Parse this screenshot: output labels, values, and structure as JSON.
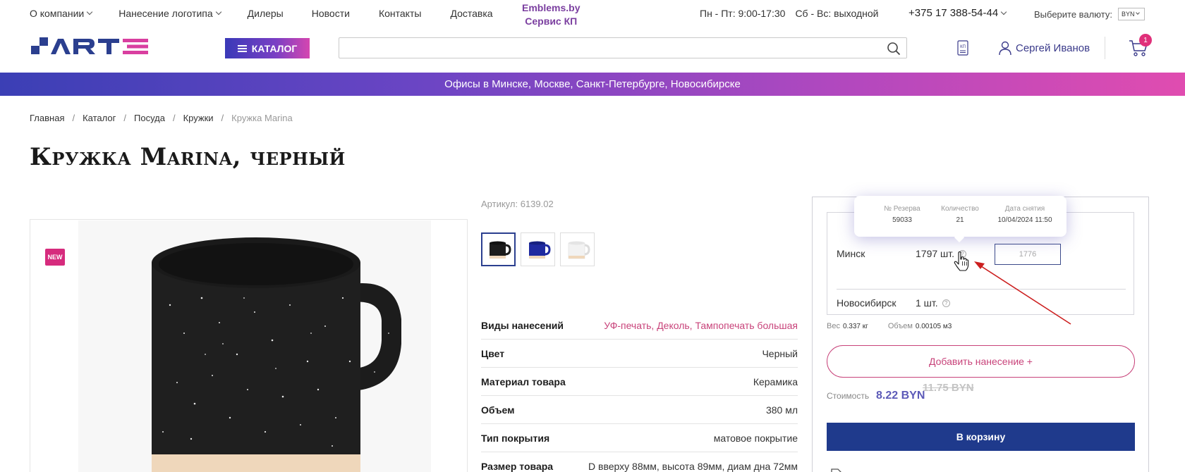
{
  "topbar": {
    "nav": [
      {
        "label": "О компании",
        "dropdown": true
      },
      {
        "label": "Нанесение логотипа",
        "dropdown": true
      },
      {
        "label": "Дилеры",
        "dropdown": false
      },
      {
        "label": "Новости",
        "dropdown": false
      },
      {
        "label": "Контакты",
        "dropdown": false
      },
      {
        "label": "Доставка",
        "dropdown": false
      }
    ],
    "emblems_line1": "Emblems.by",
    "emblems_line2": "Сервис КП",
    "hours_weekdays": "Пн - Пт: 9:00-17:30",
    "hours_weekend": "Сб - Вс: выходной",
    "phone": "+375 17 388-54-44",
    "currency_label": "Выберите валюту:",
    "currency_value": "BYN"
  },
  "header": {
    "logo_text": "ARTE",
    "catalog_label": "КАТАЛОГ",
    "search_placeholder": "",
    "kp_label": "КП",
    "user_name": "Сергей Иванов",
    "cart_count": "1"
  },
  "banner": "Офисы в Минске, Москве, Санкт-Петербурге, Новосибирске",
  "breadcrumbs": [
    "Главная",
    "Каталог",
    "Посуда",
    "Кружки",
    "Кружка Marina"
  ],
  "product": {
    "title": "Кружка Marina, черный",
    "badge": "NEW",
    "sku": "Артикул: 6139.02",
    "thumb_colors": [
      "#1c1c1c",
      "#1f2aa0",
      "#f2f2f2"
    ],
    "properties": [
      {
        "key": "Виды нанесений",
        "value": "УФ-печать, Деколь, Тампопечать большая",
        "accent": true
      },
      {
        "key": "Цвет",
        "value": "Черный",
        "accent": false
      },
      {
        "key": "Материал товара",
        "value": "Керамика",
        "accent": false
      },
      {
        "key": "Объем",
        "value": "380 мл",
        "accent": false
      },
      {
        "key": "Тип покрытия",
        "value": "матовое покрытие",
        "accent": false
      },
      {
        "key": "Размер товара",
        "value": "D вверху 88мм, высота 89мм, диам дна 72мм",
        "accent": false
      }
    ]
  },
  "panel": {
    "stock": [
      {
        "city": "Минск",
        "qty": "1797 шт."
      },
      {
        "city": "Новосибирск",
        "qty": "1 шт."
      }
    ],
    "qty_input_value": "1776",
    "weight_label": "Вес",
    "weight_value": "0.337 кг",
    "volume_label": "Объем",
    "volume_value": "0.00105 м3",
    "add_print_label": "Добавить нанесение +",
    "price_label": "Стоимость",
    "price": "8.22 BYN",
    "old_price": "11.75 BYN",
    "to_cart_label": "В корзину"
  },
  "tooltip": {
    "cols": [
      {
        "label": "№ Резерва",
        "value": "59033"
      },
      {
        "label": "Количество",
        "value": "21"
      },
      {
        "label": "Дата снятия",
        "value": "10/04/2024 11:50"
      }
    ]
  },
  "colors": {
    "brand_blue": "#1f3a8c",
    "accent_pink": "#c8437a",
    "price_purple": "#5c5ab8",
    "annotation_red": "#cc1f1f"
  }
}
